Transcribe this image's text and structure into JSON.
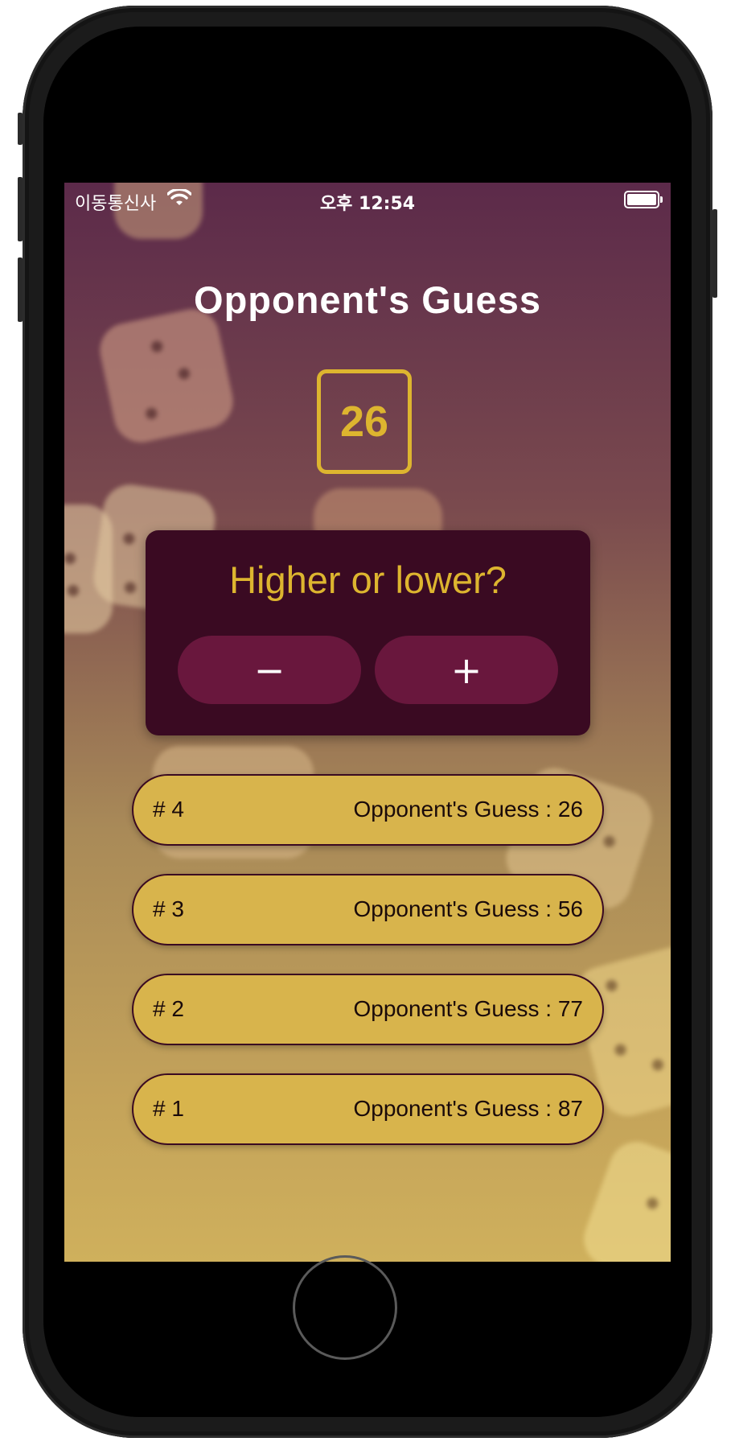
{
  "status_bar": {
    "carrier": "이동통신사",
    "time": "오후 12:54",
    "wifi_icon": "wifi-icon",
    "battery_icon": "battery-full-icon"
  },
  "title": "Opponent's Guess",
  "current_guess": "26",
  "prompt": {
    "question": "Higher or lower?",
    "minus_label": "−",
    "plus_label": "+"
  },
  "guess_log": [
    {
      "round": "# 4",
      "text": "Opponent's Guess : 26"
    },
    {
      "round": "# 3",
      "text": "Opponent's Guess : 56"
    },
    {
      "round": "# 2",
      "text": "Opponent's Guess : 77"
    },
    {
      "round": "# 1",
      "text": "Opponent's Guess : 87"
    }
  ],
  "colors": {
    "accent": "#ddb52f",
    "card_bg": "#3a0a22",
    "button_bg": "#69173d",
    "log_item_bg": "#d8b44c"
  }
}
